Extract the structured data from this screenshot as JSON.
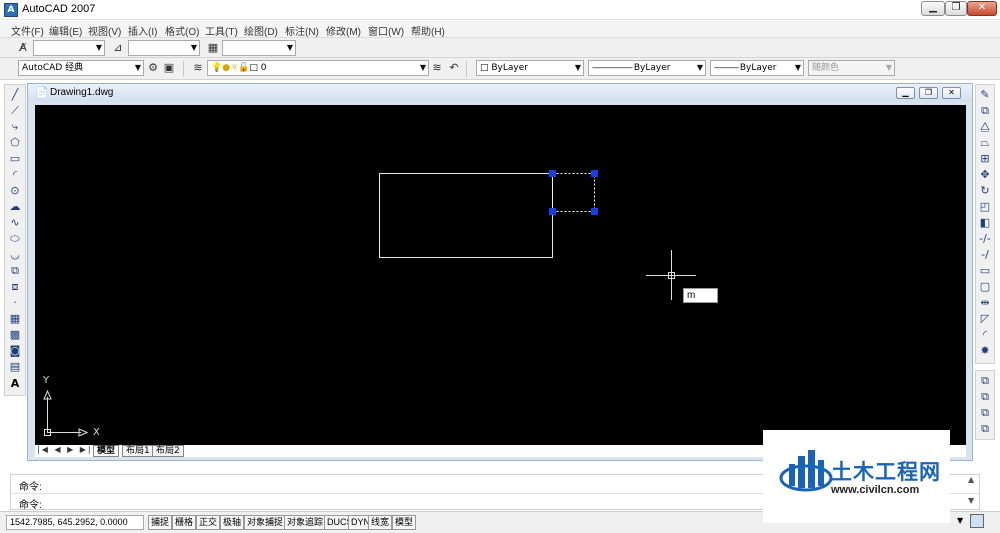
{
  "window": {
    "title": "AutoCAD 2007",
    "app_icon": "cad-icon"
  },
  "menu": {
    "items": [
      "文件(F)",
      "编辑(E)",
      "视图(V)",
      "插入(I)",
      "格式(O)",
      "工具(T)",
      "绘图(D)",
      "标注(N)",
      "修改(M)",
      "窗口(W)",
      "帮助(H)"
    ]
  },
  "toolbar2": {
    "combo1": "",
    "combo2": "",
    "combo3": ""
  },
  "toolbar3": {
    "workspace": "AutoCAD 经典",
    "layer": "0",
    "color": "ByLayer",
    "linetype": "ByLayer",
    "lineweight": "ByLayer",
    "plotstyle": "随颜色"
  },
  "document": {
    "title": "Drawing1.dwg"
  },
  "canvas": {
    "input_tooltip": "m",
    "ucs_x": "X",
    "ucs_y": "Y"
  },
  "tabs": [
    "模型",
    "布局1",
    "布局2"
  ],
  "command": {
    "line1": "命令:",
    "line2": "命令:"
  },
  "status": {
    "coords": "1542.7985, 645.2952, 0.0000",
    "buttons": [
      "捕捉",
      "栅格",
      "正交",
      "极轴",
      "对象捕捉",
      "对象追踪",
      "DUCS",
      "DYN",
      "线宽",
      "模型"
    ]
  },
  "watermark": {
    "name": "土木工程网",
    "url": "www.civilcn.com"
  },
  "colors": {
    "canvas": "#000000",
    "grip": "#1a3fe0",
    "watermark_blue": "#1a64b8"
  }
}
